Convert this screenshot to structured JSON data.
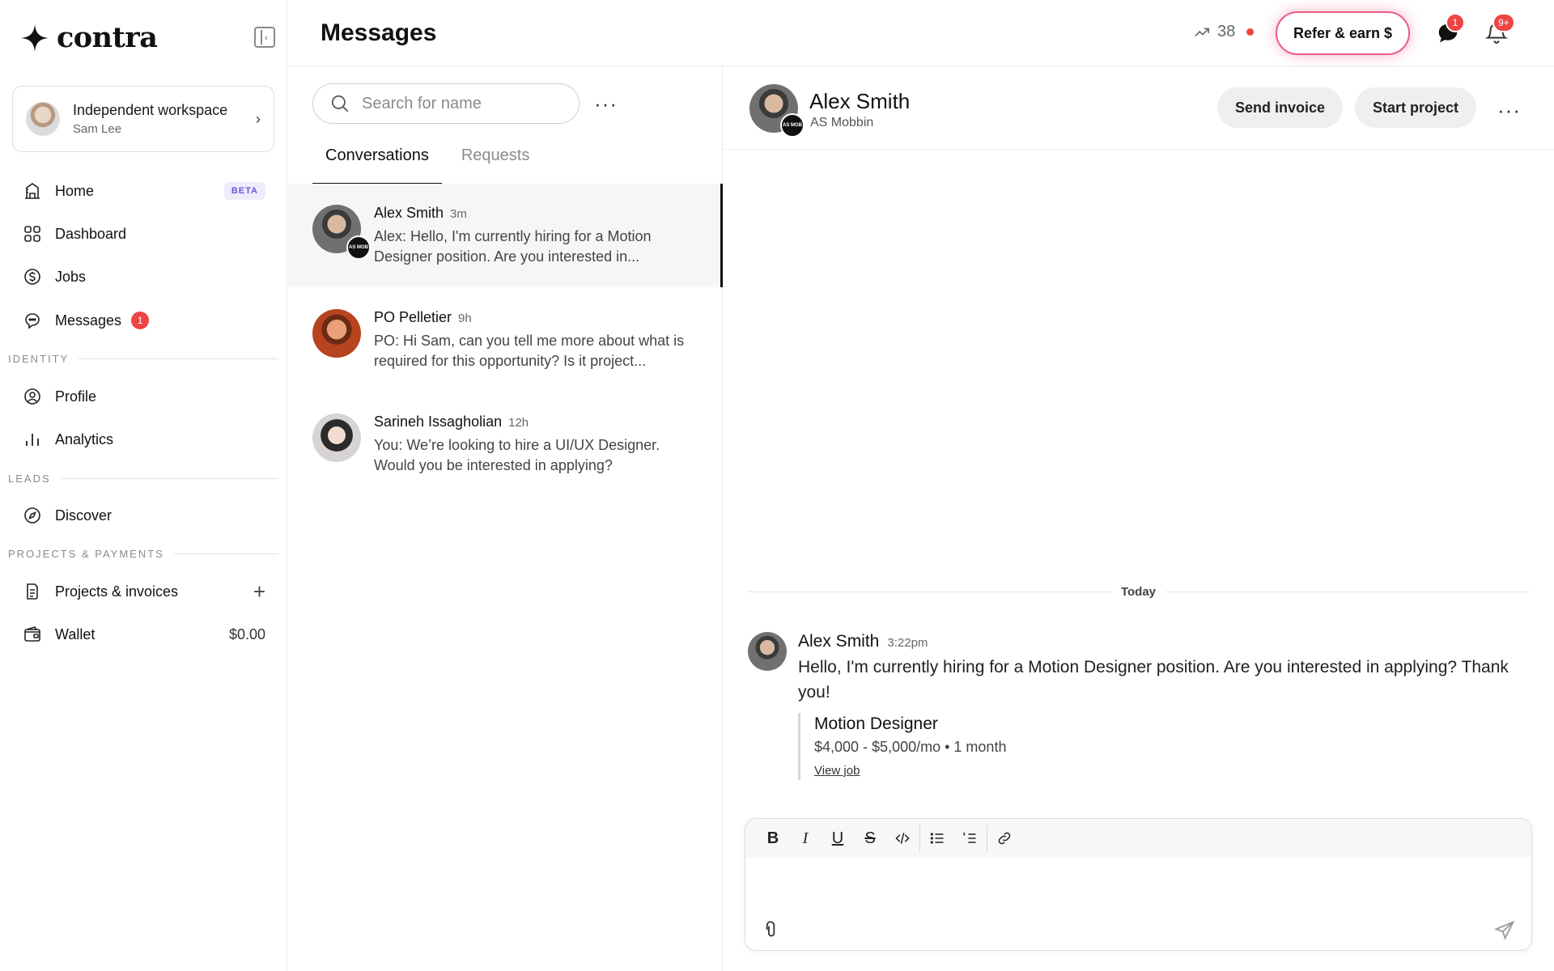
{
  "brand": {
    "logo_text": "contra"
  },
  "workspace": {
    "title": "Independent workspace",
    "user": "Sam Lee"
  },
  "nav": {
    "home": {
      "label": "Home",
      "badge": "BETA"
    },
    "dashboard": {
      "label": "Dashboard"
    },
    "jobs": {
      "label": "Jobs"
    },
    "messages": {
      "label": "Messages",
      "count": "1"
    },
    "identity_section": "IDENTITY",
    "profile": {
      "label": "Profile"
    },
    "analytics": {
      "label": "Analytics"
    },
    "leads_section": "LEADS",
    "discover": {
      "label": "Discover"
    },
    "projects_section": "PROJECTS & PAYMENTS",
    "projects": {
      "label": "Projects & invoices"
    },
    "wallet": {
      "label": "Wallet",
      "balance": "$0.00"
    }
  },
  "topbar": {
    "title": "Messages",
    "streak_count": "38",
    "refer_label": "Refer & earn $",
    "chat_badge": "1",
    "notif_badge": "9+"
  },
  "convlist": {
    "search_placeholder": "Search for name",
    "tabs": [
      "Conversations",
      "Requests"
    ],
    "items": [
      {
        "name": "Alex Smith",
        "time": "3m",
        "preview": "Alex: Hello, I'm currently hiring for a Motion Designer position. Are you interested in..."
      },
      {
        "name": "PO Pelletier",
        "time": "9h",
        "preview": "PO: Hi Sam, can you tell me more about what is required for this opportunity? Is it project..."
      },
      {
        "name": "Sarineh Issagholian",
        "time": "12h",
        "preview": "You: We’re looking to hire a UI/UX Designer. Would you be interested in applying?"
      }
    ]
  },
  "chat": {
    "name": "Alex Smith",
    "company": "AS Mobbin",
    "send_invoice": "Send invoice",
    "start_project": "Start project",
    "date_divider": "Today",
    "message": {
      "sender": "Alex Smith",
      "time": "3:22pm",
      "text": "Hello, I'm currently hiring for a Motion Designer position. Are you interested in applying? Thank you!",
      "job": {
        "title": "Motion Designer",
        "meta": "$4,000 - $5,000/mo • 1 month",
        "link": "View job"
      }
    },
    "toolbar": {
      "bold": "B",
      "italic": "I",
      "underline": "U",
      "strike": "S"
    }
  },
  "colors": {
    "accent_red": "#ef4444",
    "refer_border": "#ec5b83",
    "beta_text": "#6b57d6",
    "beta_bg": "#efedfb"
  },
  "icons": [
    "contra-star-logo",
    "sidebar-collapse-icon",
    "home-icon",
    "dashboard-grid-icon",
    "dollar-circle-icon",
    "messages-icon",
    "profile-icon",
    "analytics-icon",
    "compass-icon",
    "document-icon",
    "wallet-icon",
    "trend-up-icon",
    "chat-bubble-icon",
    "bell-icon",
    "search-icon",
    "paperclip-icon",
    "send-icon"
  ]
}
